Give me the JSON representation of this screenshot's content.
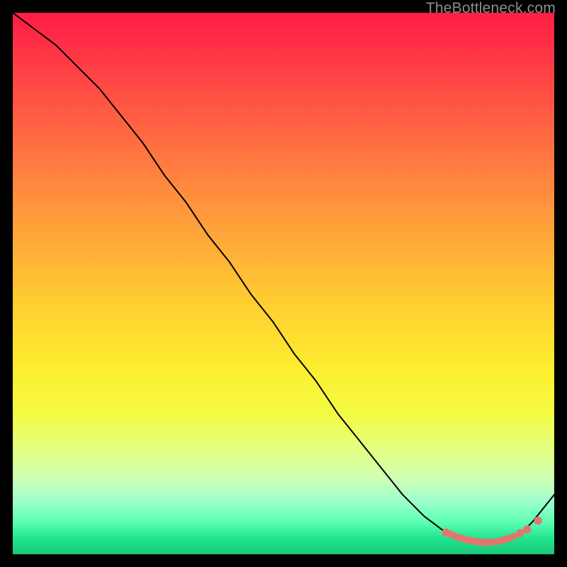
{
  "watermark": "TheBottleneck.com",
  "colors": {
    "curve_stroke": "#000000",
    "marker_fill": "#e2766f",
    "marker_stroke": "#e2766f"
  },
  "chart_data": {
    "type": "line",
    "title": "",
    "xlabel": "",
    "ylabel": "",
    "xlim": [
      0,
      100
    ],
    "ylim": [
      0,
      100
    ],
    "grid": false,
    "legend": false,
    "series": [
      {
        "name": "bottleneck-curve",
        "x": [
          0,
          4,
          8,
          12,
          16,
          20,
          24,
          28,
          32,
          36,
          40,
          44,
          48,
          52,
          56,
          60,
          64,
          68,
          72,
          76,
          80,
          82,
          84,
          86,
          88,
          90,
          92,
          94,
          96,
          98,
          100
        ],
        "y": [
          100,
          97,
          94,
          90,
          86,
          81,
          76,
          70,
          65,
          59,
          54,
          48,
          43,
          37,
          32,
          26,
          21,
          16,
          11,
          7,
          4,
          3,
          2.5,
          2.2,
          2.2,
          2.4,
          3,
          4,
          6,
          8.5,
          11
        ]
      }
    ],
    "markers": {
      "name": "highlight-dots",
      "x": [
        80.0,
        80.8,
        81.6,
        82.3,
        83.0,
        83.6,
        84.2,
        84.7,
        85.3,
        85.8,
        86.3,
        86.8,
        87.3,
        87.8,
        88.3,
        88.9,
        89.4,
        90.0,
        90.5,
        91.1,
        91.8,
        92.5,
        93.7,
        95.0,
        97.0
      ],
      "y": [
        4.0,
        3.7,
        3.4,
        3.1,
        2.9,
        2.7,
        2.6,
        2.5,
        2.4,
        2.3,
        2.25,
        2.2,
        2.2,
        2.2,
        2.22,
        2.28,
        2.36,
        2.46,
        2.6,
        2.78,
        3.0,
        3.28,
        3.9,
        4.6,
        6.2
      ]
    }
  }
}
